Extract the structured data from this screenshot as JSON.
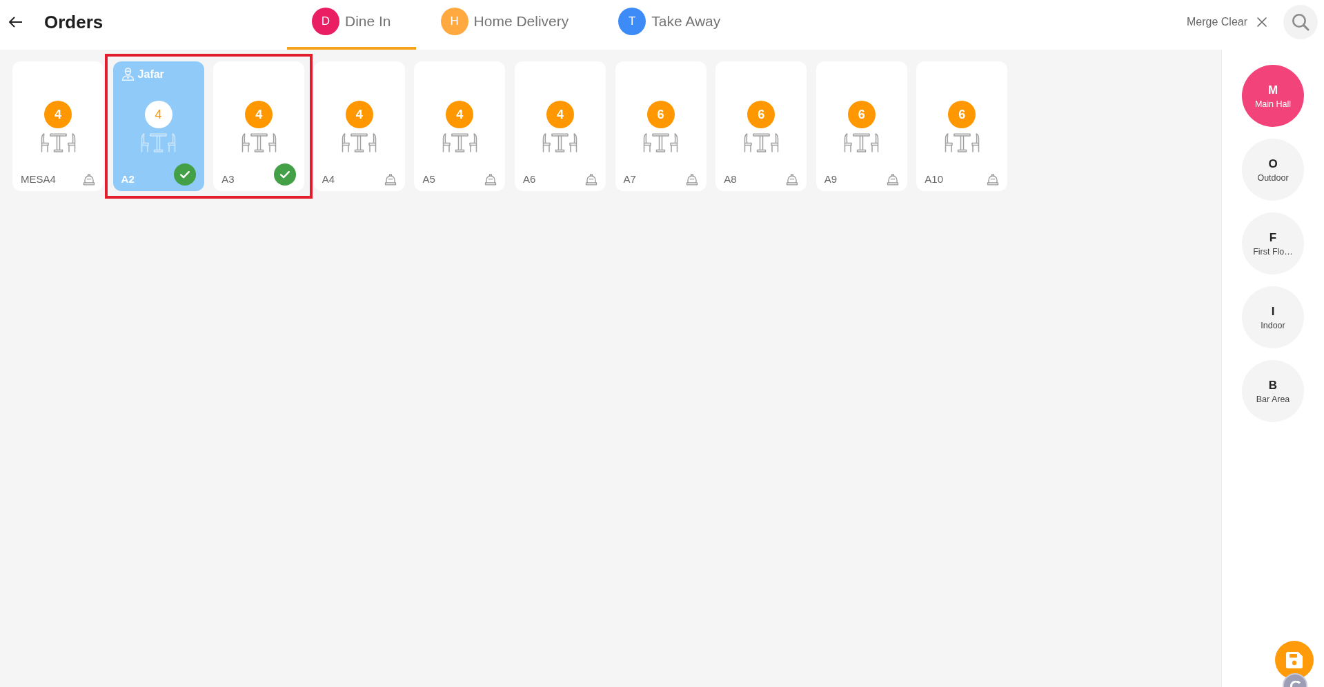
{
  "header": {
    "title": "Orders",
    "order_types": [
      {
        "initial": "D",
        "label": "Dine In",
        "color": "#e91e63",
        "selected": true
      },
      {
        "initial": "H",
        "label": "Home Delivery",
        "color": "#ffa940",
        "selected": false
      },
      {
        "initial": "T",
        "label": "Take Away",
        "color": "#3d8bf7",
        "selected": false
      }
    ],
    "merge_clear": "Merge Clear"
  },
  "tables": [
    {
      "name": "MESA4",
      "capacity": "4",
      "occupied": false,
      "checked": false,
      "highlighted": false
    },
    {
      "name": "A2",
      "capacity": "4",
      "occupied": true,
      "waiter": "Jafar",
      "checked": true,
      "highlighted": true
    },
    {
      "name": "A3",
      "capacity": "4",
      "occupied": false,
      "checked": true,
      "highlighted": true
    },
    {
      "name": "A4",
      "capacity": "4",
      "occupied": false,
      "checked": false,
      "highlighted": false
    },
    {
      "name": "A5",
      "capacity": "4",
      "occupied": false,
      "checked": false,
      "highlighted": false
    },
    {
      "name": "A6",
      "capacity": "4",
      "occupied": false,
      "checked": false,
      "highlighted": false
    },
    {
      "name": "A7",
      "capacity": "6",
      "occupied": false,
      "checked": false,
      "highlighted": false
    },
    {
      "name": "A8",
      "capacity": "6",
      "occupied": false,
      "checked": false,
      "highlighted": false
    },
    {
      "name": "A9",
      "capacity": "6",
      "occupied": false,
      "checked": false,
      "highlighted": false
    },
    {
      "name": "A10",
      "capacity": "6",
      "occupied": false,
      "checked": false,
      "highlighted": false
    }
  ],
  "areas": [
    {
      "initial": "M",
      "label": "Main Hall",
      "selected": true
    },
    {
      "initial": "O",
      "label": "Outdoor",
      "selected": false
    },
    {
      "initial": "F",
      "label": "First Flo…",
      "selected": false
    },
    {
      "initial": "I",
      "label": "Indoor",
      "selected": false
    },
    {
      "initial": "B",
      "label": "Bar Area",
      "selected": false
    }
  ]
}
